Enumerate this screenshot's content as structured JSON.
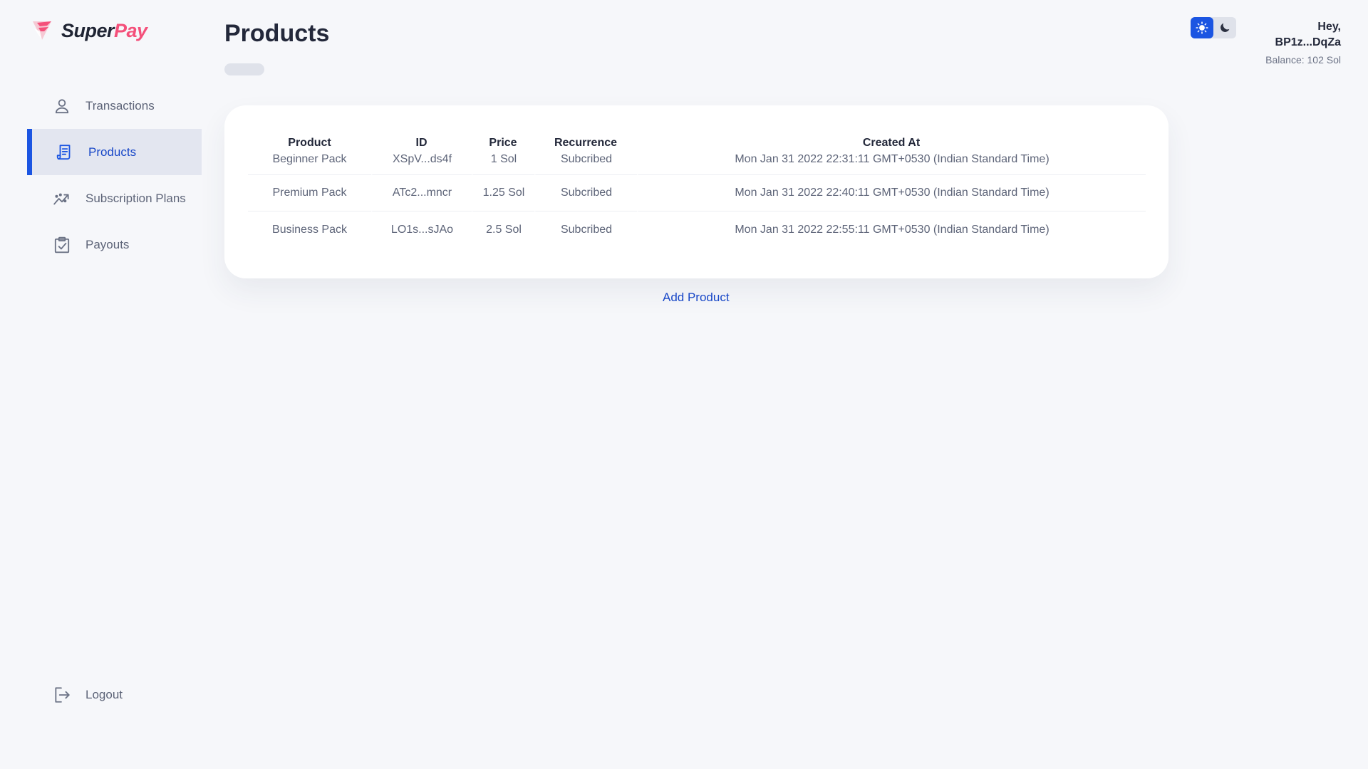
{
  "brand": {
    "name_part1": "Super",
    "name_part2": "Pay",
    "color_accent": "#f4507a"
  },
  "sidebar": {
    "items": [
      {
        "label": "Transactions",
        "icon": "user-icon",
        "active": false
      },
      {
        "label": "Products",
        "icon": "receipt-icon",
        "active": true
      },
      {
        "label": "Subscription Plans",
        "icon": "trending-icon",
        "active": false
      },
      {
        "label": "Payouts",
        "icon": "clipboard-check-icon",
        "active": false
      }
    ],
    "logout_label": "Logout"
  },
  "page": {
    "title": "Products"
  },
  "theme": {
    "light_icon": "sun-icon",
    "dark_icon": "moon-icon",
    "active": "light",
    "accent": "#1b55e2"
  },
  "user": {
    "greeting": "Hey,",
    "address": "BP1z...DqZa",
    "balance": "Balance: 102 Sol"
  },
  "table": {
    "headers": [
      "Product",
      "ID",
      "Price",
      "Recurrence",
      "Created At"
    ],
    "rows": [
      [
        "Beginner Pack",
        "XSpV...ds4f",
        "1 Sol",
        "Subcribed",
        "Mon Jan 31 2022 22:31:11 GMT+0530 (Indian Standard Time)"
      ],
      [
        "Premium Pack",
        "ATc2...mncr",
        "1.25 Sol",
        "Subcribed",
        "Mon Jan 31 2022 22:40:11 GMT+0530 (Indian Standard Time)"
      ],
      [
        "Business Pack",
        "LO1s...sJAo",
        "2.5 Sol",
        "Subcribed",
        "Mon Jan 31 2022 22:55:11 GMT+0530 (Indian Standard Time)"
      ]
    ]
  },
  "actions": {
    "add_product": "Add Product"
  }
}
